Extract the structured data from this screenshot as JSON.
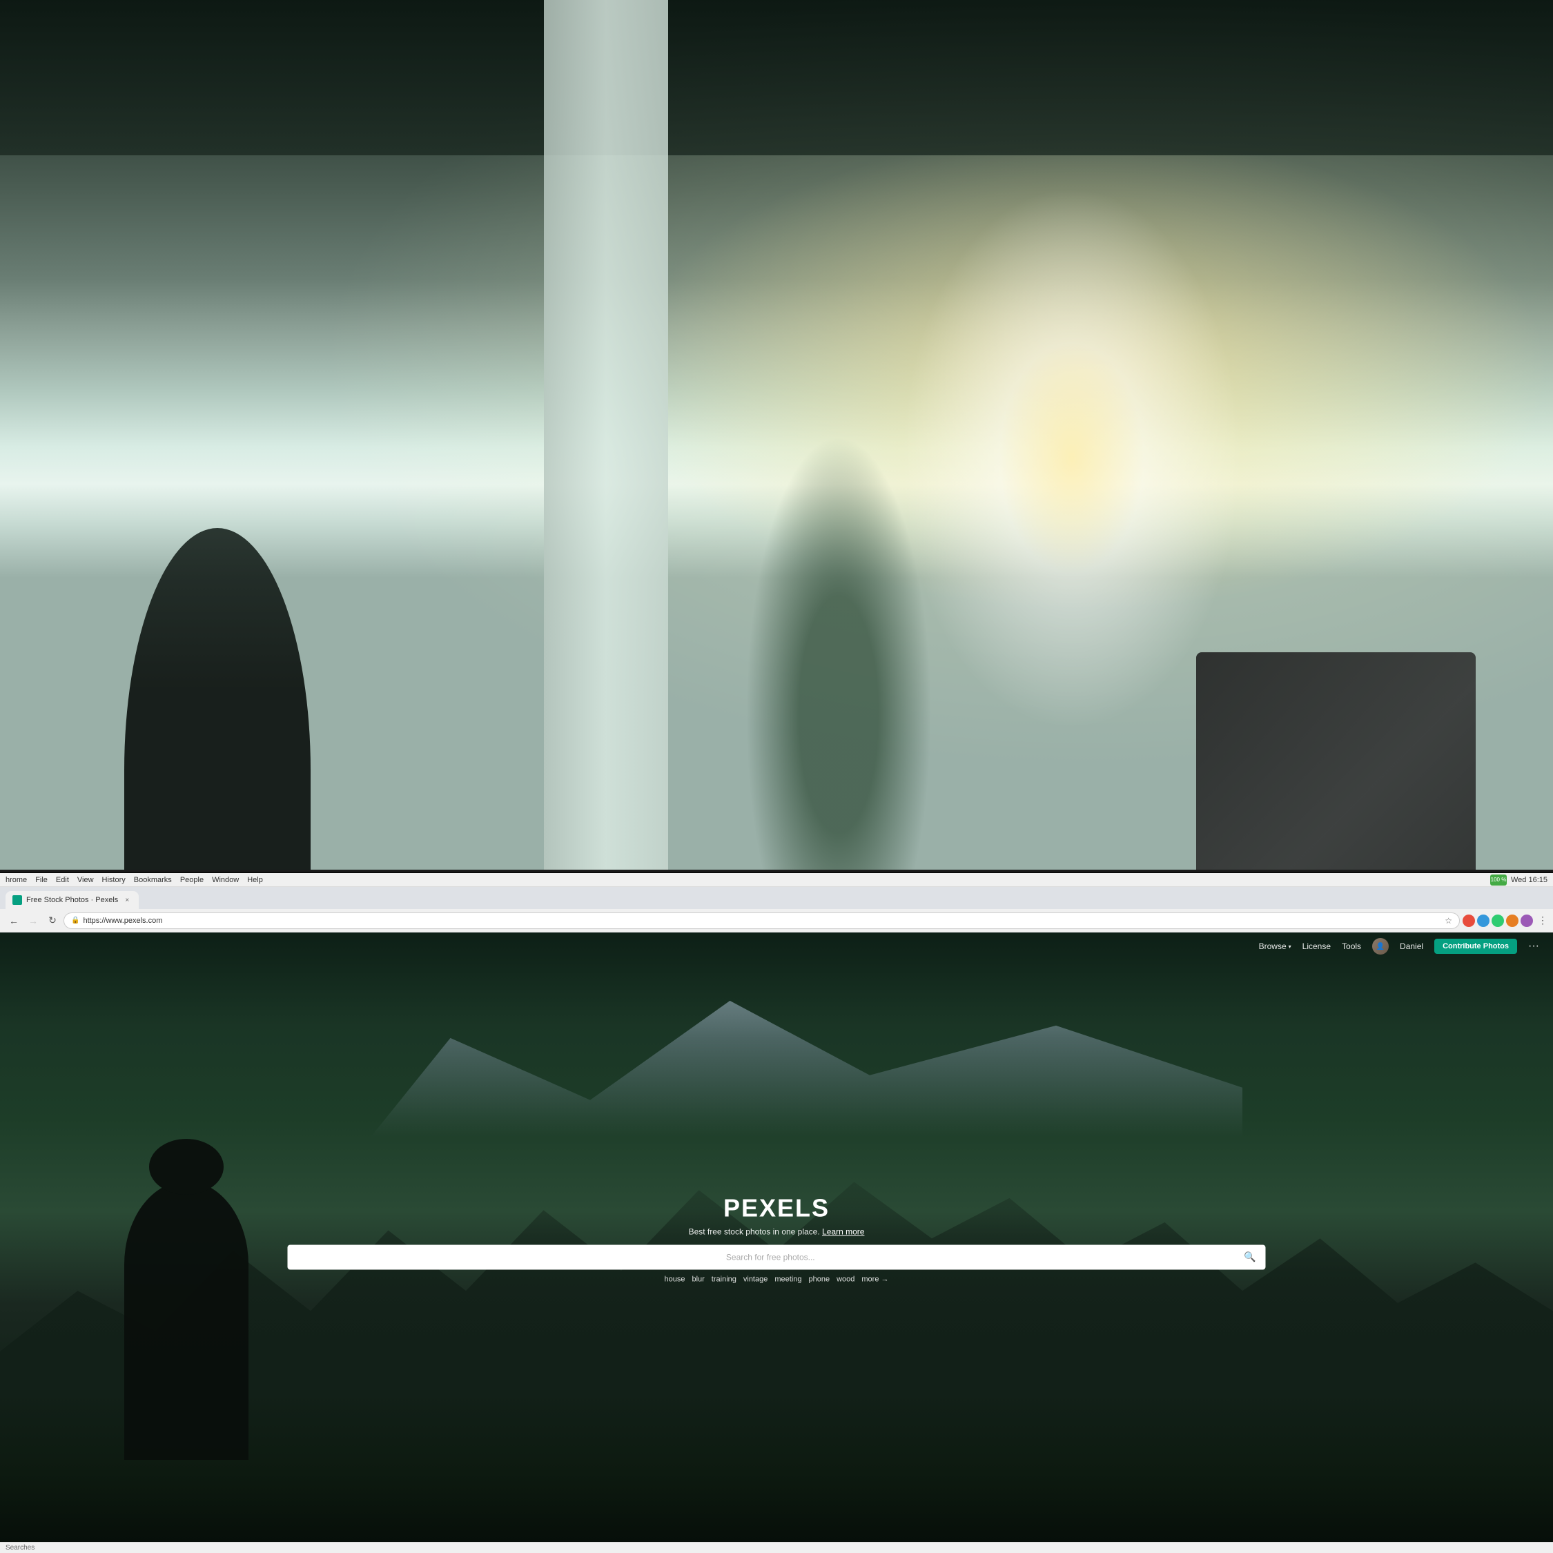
{
  "photo": {
    "description": "Office interior background photo",
    "alt": "Blurred office interior with plants, windows and pillar"
  },
  "browser": {
    "tab": {
      "title": "Free Stock Photos · Pexels",
      "favicon_color": "#05a081"
    },
    "menu_items": [
      "hrome",
      "File",
      "Edit",
      "View",
      "History",
      "Bookmarks",
      "People",
      "Window",
      "Help"
    ],
    "address": {
      "secure_label": "Secure",
      "url": "https://www.pexels.com"
    },
    "system": {
      "battery": "100 %",
      "time": "Wed 16:15"
    },
    "close_label": "×"
  },
  "pexels": {
    "nav": {
      "browse_label": "Browse",
      "license_label": "License",
      "tools_label": "Tools",
      "user_name": "Daniel",
      "contribute_label": "Contribute Photos",
      "more_label": "···"
    },
    "hero": {
      "logo": "PEXELS",
      "tagline": "Best free stock photos in one place.",
      "learn_more": "Learn more",
      "search_placeholder": "Search for free photos...",
      "suggestions": [
        "house",
        "blur",
        "training",
        "vintage",
        "meeting",
        "phone",
        "wood"
      ],
      "more_label": "more →"
    }
  }
}
